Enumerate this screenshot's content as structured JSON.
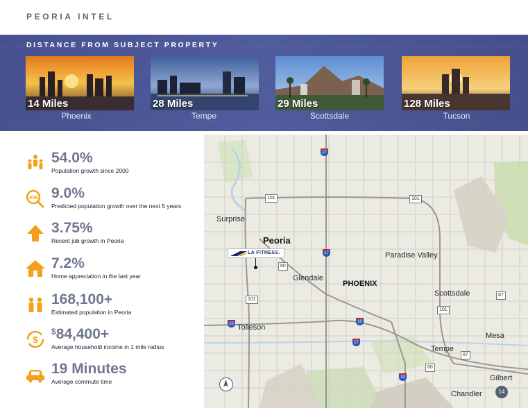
{
  "page": {
    "title": "PEORIA INTEL"
  },
  "banner": {
    "title": "DISTANCE FROM SUBJECT PROPERTY",
    "cities": [
      {
        "distance": "14 Miles",
        "name": "Phoenix"
      },
      {
        "distance": "28 Miles",
        "name": "Tempe"
      },
      {
        "distance": "29 Miles",
        "name": "Scottsdale"
      },
      {
        "distance": "128 Miles",
        "name": "Tucson"
      }
    ]
  },
  "stats": [
    {
      "icon": "people-icon",
      "value": "54.0%",
      "label": "Population growth since 2000"
    },
    {
      "icon": "job-search-icon",
      "value": "9.0%",
      "label": "Predicted population growth over the next 5 years"
    },
    {
      "icon": "arrow-up-icon",
      "value": "3.75%",
      "label": "Recent job growth in Peoria"
    },
    {
      "icon": "house-icon",
      "value": "7.2%",
      "label": "Home appreciation in the last year"
    },
    {
      "icon": "family-icon",
      "value": "168,100+",
      "label": "Estimated population in Peoria"
    },
    {
      "icon": "dollar-cycle-icon",
      "value_prefix": "$",
      "value": "84,400+",
      "label": "Average household income in 1 mile radius"
    },
    {
      "icon": "car-icon",
      "value": "19 Minutes",
      "label": "Average commute time"
    }
  ],
  "map": {
    "labels": {
      "surprise": "Surprise",
      "peoria": "Peoria",
      "glendale": "Glendale",
      "phoenix": "PHOENIX",
      "paradise_valley": "Paradise Valley",
      "scottsdale": "Scottsdale",
      "tolleson": "Tolleson",
      "tempe": "Tempe",
      "mesa": "Mesa",
      "gilbert": "Gilbert",
      "chandler": "Chandler"
    },
    "shields": {
      "i17_north": "17",
      "i17_mid": "17",
      "i17_south": "17",
      "i10_west": "10",
      "i10_mid": "10",
      "i10_south": "10",
      "us60": "60",
      "us60_se": "60",
      "sr101_nw": "101",
      "sr101_ne": "101",
      "sr101_e": "101",
      "sr101_w": "101",
      "sr87": "87",
      "sr87_s": "87",
      "route14": "14"
    },
    "marker": {
      "brand": "LA FITNESS."
    },
    "colors": {
      "water": "#b9d3e6",
      "park": "#cfe0b4",
      "road": "#bfbcb4"
    }
  },
  "colors": {
    "banner": "#4a5596",
    "accent": "#f3a11c",
    "stat_value": "#6f7790"
  }
}
